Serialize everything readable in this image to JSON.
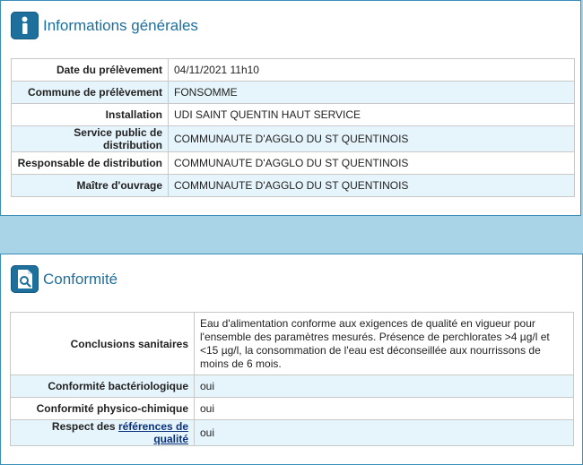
{
  "general": {
    "title": "Informations générales",
    "rows": [
      {
        "label": "Date du prélèvement",
        "value": "04/11/2021  11h10"
      },
      {
        "label": "Commune de prélèvement",
        "value": "FONSOMME"
      },
      {
        "label": "Installation",
        "value": "UDI SAINT QUENTIN HAUT SERVICE"
      },
      {
        "label": "Service public de distribution",
        "value": "COMMUNAUTE D'AGGLO DU ST QUENTINOIS"
      },
      {
        "label": "Responsable de distribution",
        "value": "COMMUNAUTE D'AGGLO DU ST QUENTINOIS"
      },
      {
        "label": "Maître d'ouvrage",
        "value": "COMMUNAUTE D'AGGLO DU ST QUENTINOIS"
      }
    ]
  },
  "conformite": {
    "title": "Conformité",
    "rows": [
      {
        "label": "Conclusions sanitaires",
        "value": "Eau d'alimentation conforme aux exigences de qualité en vigueur pour l'ensemble des paramètres mesurés. Présence de perchlorates >4 µg/l et <15 µg/l, la consommation de l'eau est déconseillée aux nourrissons de moins de 6 mois."
      },
      {
        "label": "Conformité bactériologique",
        "value": "oui"
      },
      {
        "label": "Conformité physico-chimique",
        "value": "oui"
      },
      {
        "label_prefix": "Respect des ",
        "label_link": "références de qualité",
        "value": "oui"
      }
    ]
  },
  "icons": {
    "info": "info-icon",
    "conformite": "document-search-icon"
  },
  "colors": {
    "accent": "#1d6f9c",
    "row_alt": "#e6f5fb",
    "background": "#a9d3e6"
  }
}
